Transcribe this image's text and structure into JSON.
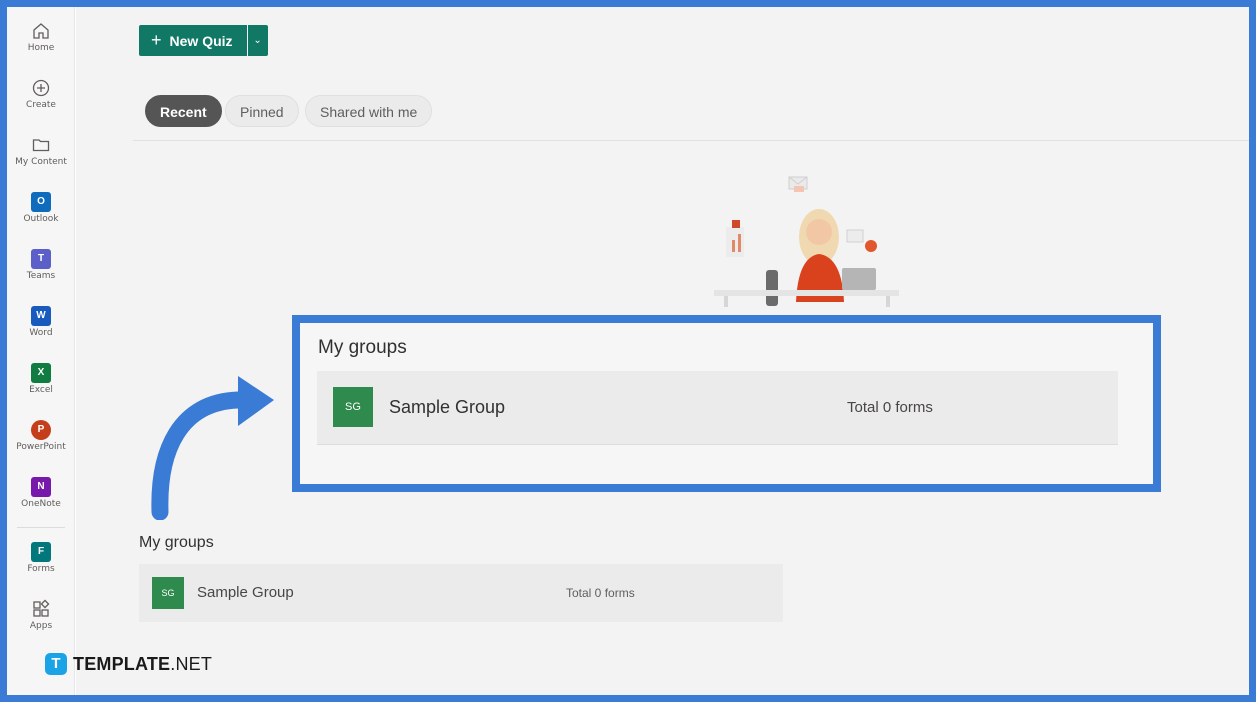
{
  "rail": {
    "items": [
      {
        "label": "Home",
        "icon": "home-icon"
      },
      {
        "label": "Create",
        "icon": "plus-circle-icon"
      },
      {
        "label": "My Content",
        "icon": "folder-icon"
      },
      {
        "label": "Outlook",
        "icon": "outlook-icon",
        "letter": "O",
        "color": "#0f6cbd"
      },
      {
        "label": "Teams",
        "icon": "teams-icon",
        "letter": "T",
        "color": "#5b5fc7"
      },
      {
        "label": "Word",
        "icon": "word-icon",
        "letter": "W",
        "color": "#185abd"
      },
      {
        "label": "Excel",
        "icon": "excel-icon",
        "letter": "X",
        "color": "#107c41"
      },
      {
        "label": "PowerPoint",
        "icon": "powerpoint-icon",
        "letter": "P",
        "color": "#c43e1c"
      },
      {
        "label": "OneNote",
        "icon": "onenote-icon",
        "letter": "N",
        "color": "#7719aa"
      },
      {
        "label": "Forms",
        "icon": "forms-icon",
        "letter": "F",
        "color": "#03787c"
      },
      {
        "label": "Apps",
        "icon": "apps-icon"
      }
    ]
  },
  "toolbar": {
    "new_quiz_label": "New Quiz",
    "new_quiz_plus": "+",
    "dropdown_glyph": "⌄"
  },
  "tabs": [
    {
      "label": "Recent",
      "active": true
    },
    {
      "label": "Pinned",
      "active": false
    },
    {
      "label": "Shared with me",
      "active": false
    }
  ],
  "highlight": {
    "title": "My groups",
    "group": {
      "initials": "SG",
      "name": "Sample Group",
      "count": "Total 0 forms"
    }
  },
  "groups": {
    "title": "My groups",
    "items": [
      {
        "initials": "SG",
        "name": "Sample Group",
        "count": "Total 0 forms"
      }
    ]
  },
  "watermark": {
    "logo_letter": "T",
    "brand_bold": "TEMPLATE",
    "brand_light": ".NET"
  },
  "colors": {
    "frame": "#3a7bd5",
    "accent": "#117865",
    "avatar": "#2f8a4d",
    "arrow": "#3a7bd5"
  }
}
